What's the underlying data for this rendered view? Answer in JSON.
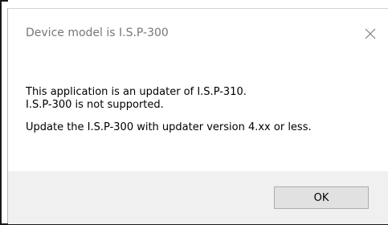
{
  "dialog": {
    "title": "Device model is I.S.P-300",
    "message_lines": [
      "This application is an updater of I.S.P-310.",
      "I.S.P-300 is not supported.",
      "Update the I.S.P-300 with updater version 4.xx or less."
    ],
    "close_icon": "close-icon",
    "ok_label": "OK"
  }
}
